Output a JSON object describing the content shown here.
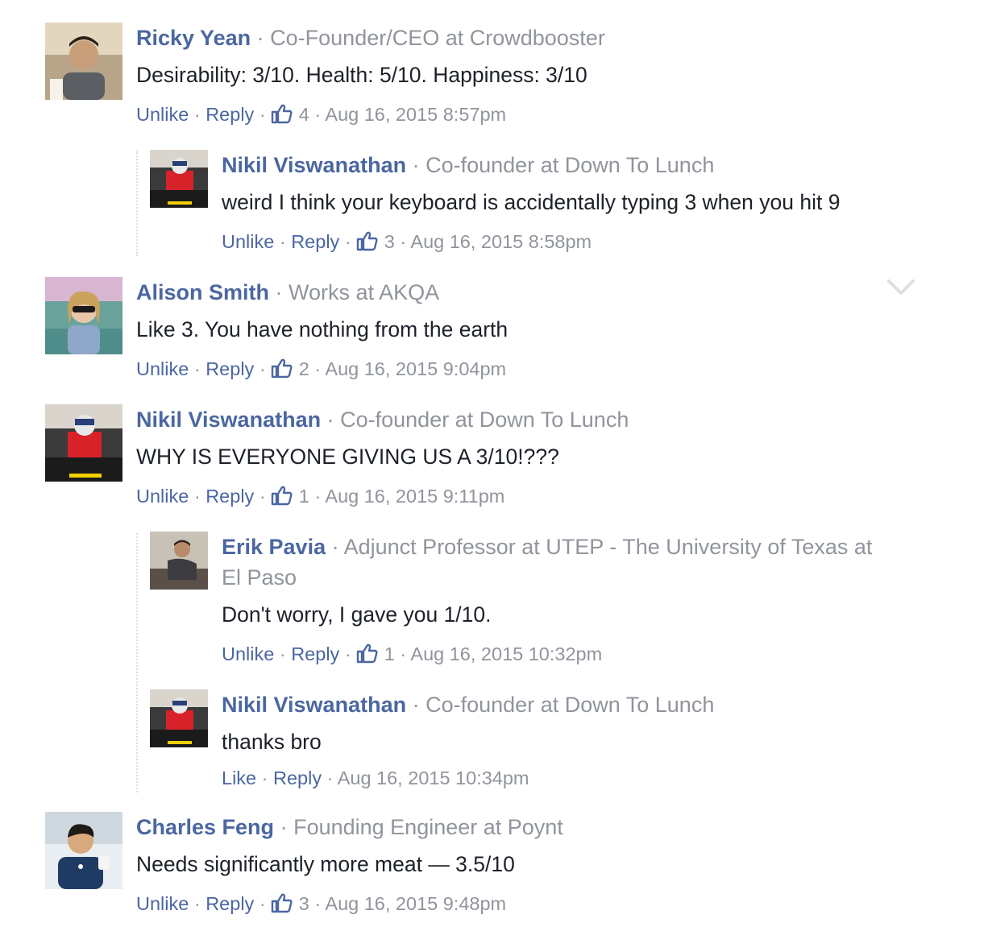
{
  "comments": [
    {
      "name": "Ricky Yean",
      "title": "Co-Founder/CEO at Crowdbooster",
      "text": "Desirability: 3/10. Health: 5/10. Happiness: 3/10",
      "like_label": "Unlike",
      "reply_label": "Reply",
      "likes": "4",
      "time": "Aug 16, 2015 8:57pm"
    },
    {
      "name": "Nikil Viswanathan",
      "title": "Co-founder at Down To Lunch",
      "text": "weird I think your keyboard is accidentally typing 3 when you hit 9",
      "like_label": "Unlike",
      "reply_label": "Reply",
      "likes": "3",
      "time": "Aug 16, 2015 8:58pm"
    },
    {
      "name": "Alison Smith",
      "title": "Works at AKQA",
      "text": "Like 3. You have nothing from the earth",
      "like_label": "Unlike",
      "reply_label": "Reply",
      "likes": "2",
      "time": "Aug 16, 2015 9:04pm"
    },
    {
      "name": "Nikil Viswanathan",
      "title": "Co-founder at Down To Lunch",
      "text": "WHY IS EVERYONE GIVING US A 3/10!???",
      "like_label": "Unlike",
      "reply_label": "Reply",
      "likes": "1",
      "time": "Aug 16, 2015 9:11pm"
    },
    {
      "name": "Erik Pavia",
      "title": "Adjunct Professor at UTEP - The University of Texas at",
      "title_line2": "El Paso",
      "text": "Don't worry, I gave you 1/10.",
      "like_label": "Unlike",
      "reply_label": "Reply",
      "likes": "1",
      "time": "Aug 16, 2015 10:32pm"
    },
    {
      "name": "Nikil Viswanathan",
      "title": "Co-founder at Down To Lunch",
      "text": "thanks bro",
      "like_label": "Like",
      "reply_label": "Reply",
      "time": "Aug 16, 2015 10:34pm"
    },
    {
      "name": "Charles Feng",
      "title": "Founding Engineer at Poynt",
      "text": "Needs significantly more meat — 3.5/10",
      "like_label": "Unlike",
      "reply_label": "Reply",
      "likes": "3",
      "time": "Aug 16, 2015 9:48pm"
    }
  ],
  "separator": "·",
  "icons": {
    "like": "thumbs-up-icon",
    "menu": "chevron-down-icon"
  },
  "colors": {
    "link": "#4b67a1",
    "meta": "#90949c",
    "text": "#1d2129"
  }
}
